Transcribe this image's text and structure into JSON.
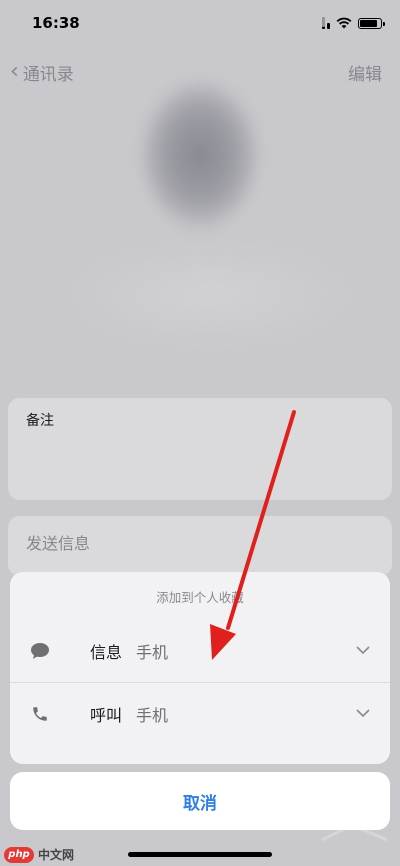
{
  "status_bar": {
    "time": "16:38"
  },
  "nav": {
    "back_label": "通讯录",
    "edit_label": "编辑"
  },
  "notes_card": {
    "label": "备注"
  },
  "send_card": {
    "label": "发送信息"
  },
  "action_sheet": {
    "title": "添加到个人收藏",
    "rows": [
      {
        "label": "信息",
        "detail": "手机",
        "icon": "message-bubble-icon"
      },
      {
        "label": "呼叫",
        "detail": "手机",
        "icon": "phone-icon"
      }
    ],
    "cancel_label": "取消"
  },
  "watermark": {
    "logo_text": "php",
    "site_text": "中文网"
  },
  "colors": {
    "accent": "#2f7fe6",
    "annotation_arrow": "#e0201c"
  }
}
